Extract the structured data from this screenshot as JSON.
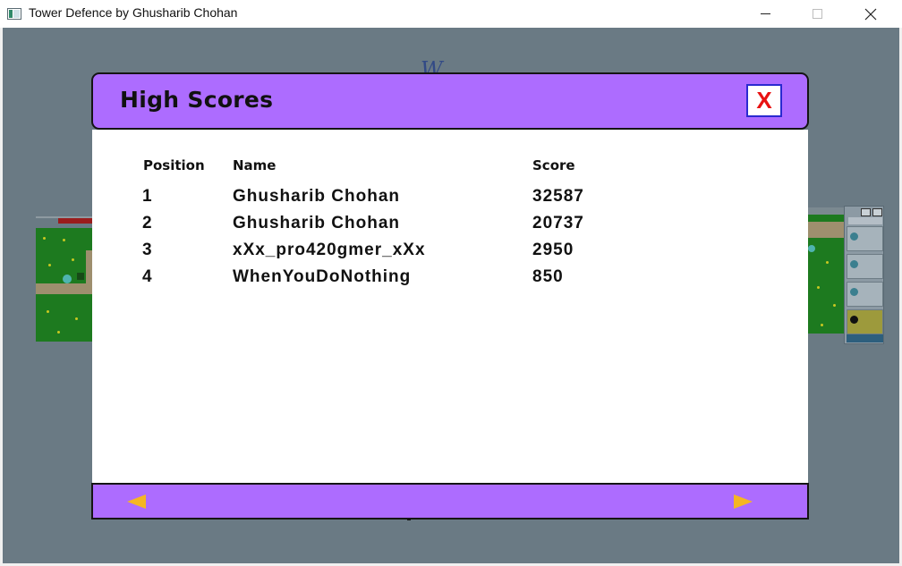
{
  "window": {
    "title": "Tower Defence by Ghusharib Chohan",
    "minimize_glyph": "",
    "close_glyph": "✕"
  },
  "background": {
    "script_text": "W"
  },
  "dialog": {
    "title": "High Scores",
    "close_label": "X",
    "columns": {
      "position": "Position",
      "name": "Name",
      "score": "Score"
    },
    "rows": [
      {
        "position": "1",
        "name": "Ghusharib Chohan",
        "score": "32587"
      },
      {
        "position": "2",
        "name": "Ghusharib Chohan",
        "score": "20737"
      },
      {
        "position": "3",
        "name": "xXx_pro420gmer_xXx",
        "score": "2950"
      },
      {
        "position": "4",
        "name": "WhenYouDoNothing",
        "score": "850"
      }
    ]
  },
  "footer": {
    "prev_icon": "arrow-left-icon",
    "next_icon": "arrow-right-icon"
  },
  "colors": {
    "header_bg": "#ad6cff",
    "arrow": "#f5b622",
    "close_text": "#e81212",
    "close_border": "#2a2ad0",
    "overlay": "#6a7a84"
  }
}
